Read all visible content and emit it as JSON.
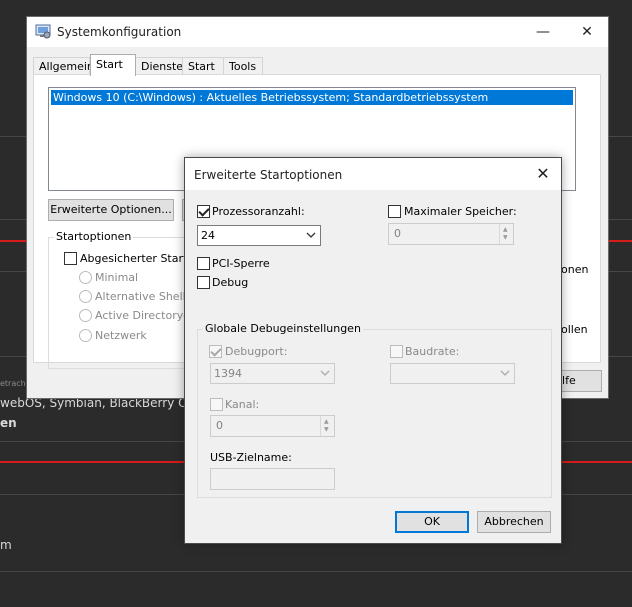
{
  "background": {
    "snippet_small": "etrach",
    "snippet_os": "webOS, Symbian, BlackBerry OS u",
    "snippet_bold": "en",
    "snippet_m": "m",
    "partial_onen": "onen",
    "partial_ollen": "ollen",
    "partial_hilfe": "ilfe"
  },
  "main_window": {
    "title": "Systemkonfiguration",
    "controls": {
      "minimize": "—",
      "close": "✕"
    },
    "tabs": [
      "Allgemein",
      "Start",
      "Dienste",
      "Start",
      "Tools"
    ],
    "active_tab": "Start",
    "os_entries": [
      "Windows 10 (C:\\Windows) : Aktuelles Betriebssystem; Standardbetriebssystem"
    ],
    "advanced_button": "Erweiterte Optionen...",
    "start_options": {
      "title": "Startoptionen",
      "safe_boot": "Abgesicherter Start",
      "radios": [
        "Minimal",
        "Alternative Shell",
        "Active Directory-Re",
        "Netzwerk"
      ]
    }
  },
  "dialog": {
    "title": "Erweiterte Startoptionen",
    "close": "✕",
    "processor_count": {
      "label": "Prozessoranzahl:",
      "checked": true,
      "value": "24"
    },
    "max_memory": {
      "label": "Maximaler Speicher:",
      "checked": false,
      "value": "0"
    },
    "pci_lock": {
      "label": "PCI-Sperre",
      "checked": false
    },
    "debug": {
      "label": "Debug",
      "checked": false
    },
    "debug_settings": {
      "title": "Globale Debugeinstellungen",
      "debug_port": {
        "label": "Debugport:",
        "checked": true,
        "value": "1394"
      },
      "baud_rate": {
        "label": "Baudrate:",
        "checked": false,
        "value": ""
      },
      "channel": {
        "label": "Kanal:",
        "checked": false,
        "value": "0"
      },
      "usb_target": {
        "label": "USB-Zielname:",
        "value": ""
      }
    },
    "ok_button": "OK",
    "cancel_button": "Abbrechen"
  }
}
